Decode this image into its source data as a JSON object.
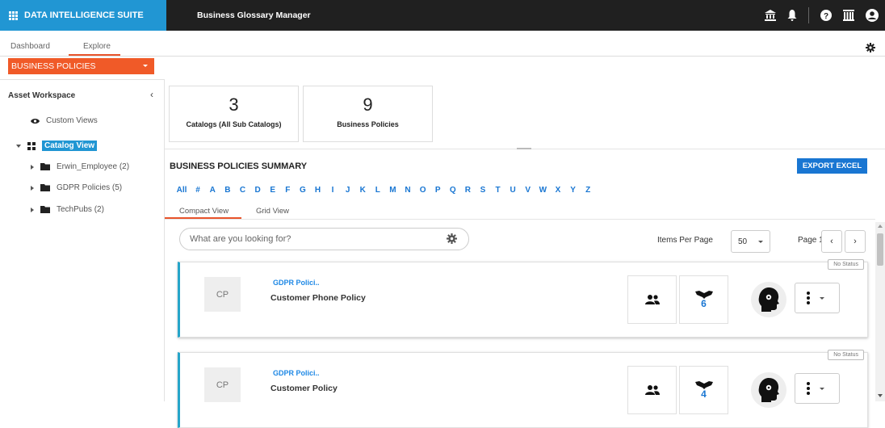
{
  "header": {
    "brand": "DATA INTELLIGENCE SUITE",
    "app_title": "Business Glossary Manager",
    "icons": [
      "bank-icon",
      "bell-icon",
      "help-icon",
      "library-icon",
      "user-icon"
    ]
  },
  "tabs": [
    {
      "label": "Dashboard",
      "active": false
    },
    {
      "label": "Explore",
      "active": true
    }
  ],
  "selector": {
    "value": "BUSINESS POLICIES"
  },
  "sidebar": {
    "title": "Asset Workspace",
    "custom_views": "Custom Views",
    "catalog_view": "Catalog View",
    "items": [
      {
        "label": "Erwin_Employee (2)"
      },
      {
        "label": "GDPR Policies (5)"
      },
      {
        "label": "TechPubs (2)"
      }
    ]
  },
  "stats": [
    {
      "value": "3",
      "label": "Catalogs (All Sub Catalogs)"
    },
    {
      "value": "9",
      "label": "Business Policies"
    }
  ],
  "summary": {
    "title": "BUSINESS POLICIES SUMMARY",
    "export_label": "EXPORT EXCEL",
    "alphabet": [
      "All",
      "#",
      "A",
      "B",
      "C",
      "D",
      "E",
      "F",
      "G",
      "H",
      "I",
      "J",
      "K",
      "L",
      "M",
      "N",
      "O",
      "P",
      "Q",
      "R",
      "S",
      "T",
      "U",
      "V",
      "W",
      "X",
      "Y",
      "Z"
    ],
    "view_tabs": [
      {
        "label": "Compact View",
        "active": true
      },
      {
        "label": "Grid View",
        "active": false
      }
    ],
    "search_placeholder": "What are you looking for?",
    "items_per_page_label": "Items Per Page",
    "items_per_page": "50",
    "page_label": "Page 1"
  },
  "policies": [
    {
      "initials": "CP",
      "catalog": "GDPR Polici..",
      "name": "Customer Phone Policy",
      "status": "No Status",
      "count": "6"
    },
    {
      "initials": "CP",
      "catalog": "GDPR Polici..",
      "name": "Customer Policy",
      "status": "No Status",
      "count": "4"
    }
  ],
  "colors": {
    "brand_blue": "#2196d3",
    "accent_orange": "#f05a28",
    "link_blue": "#1976d2",
    "topbar": "#202020"
  }
}
